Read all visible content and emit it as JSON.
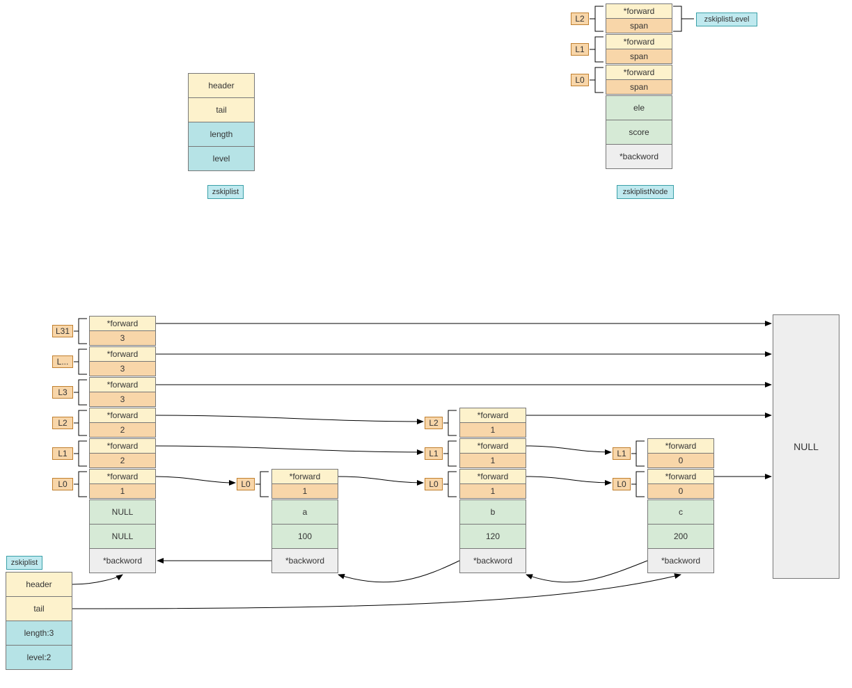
{
  "legend": {
    "zskiplist": {
      "fields": [
        "header",
        "tail",
        "length",
        "level"
      ],
      "label": "zskiplist"
    },
    "zskiplistNode": {
      "level_tags": [
        "L2",
        "L1",
        "L0"
      ],
      "levels": [
        {
          "forward": "*forward",
          "span": "span"
        },
        {
          "forward": "*forward",
          "span": "span"
        },
        {
          "forward": "*forward",
          "span": "span"
        }
      ],
      "ele": "ele",
      "score": "score",
      "backword": "*backword",
      "label": "zskiplistNode",
      "level_struct_label": "zskiplistLevel"
    }
  },
  "instance": {
    "zskiplist_label": "zskiplist",
    "zskiplist": {
      "header": "header",
      "tail": "tail",
      "length": "length:3",
      "level": "level:2"
    },
    "null_label": "NULL",
    "nodes": [
      {
        "id": "head",
        "level_tags": [
          "L31",
          "L...",
          "L3",
          "L2",
          "L1",
          "L0"
        ],
        "levels": [
          {
            "forward": "*forward",
            "span": "3"
          },
          {
            "forward": "*forward",
            "span": "3"
          },
          {
            "forward": "*forward",
            "span": "3"
          },
          {
            "forward": "*forward",
            "span": "2"
          },
          {
            "forward": "*forward",
            "span": "2"
          },
          {
            "forward": "*forward",
            "span": "1"
          }
        ],
        "ele": "NULL",
        "score": "NULL",
        "backword": "*backword"
      },
      {
        "id": "a",
        "level_tags": [
          "L0"
        ],
        "levels": [
          {
            "forward": "*forward",
            "span": "1"
          }
        ],
        "ele": "a",
        "score": "100",
        "backword": "*backword"
      },
      {
        "id": "b",
        "level_tags": [
          "L2",
          "L1",
          "L0"
        ],
        "levels": [
          {
            "forward": "*forward",
            "span": "1"
          },
          {
            "forward": "*forward",
            "span": "1"
          },
          {
            "forward": "*forward",
            "span": "1"
          }
        ],
        "ele": "b",
        "score": "120",
        "backword": "*backword"
      },
      {
        "id": "c",
        "level_tags": [
          "L1",
          "L0"
        ],
        "levels": [
          {
            "forward": "*forward",
            "span": "0"
          },
          {
            "forward": "*forward",
            "span": "0"
          }
        ],
        "ele": "c",
        "score": "200",
        "backword": "*backword"
      }
    ]
  }
}
